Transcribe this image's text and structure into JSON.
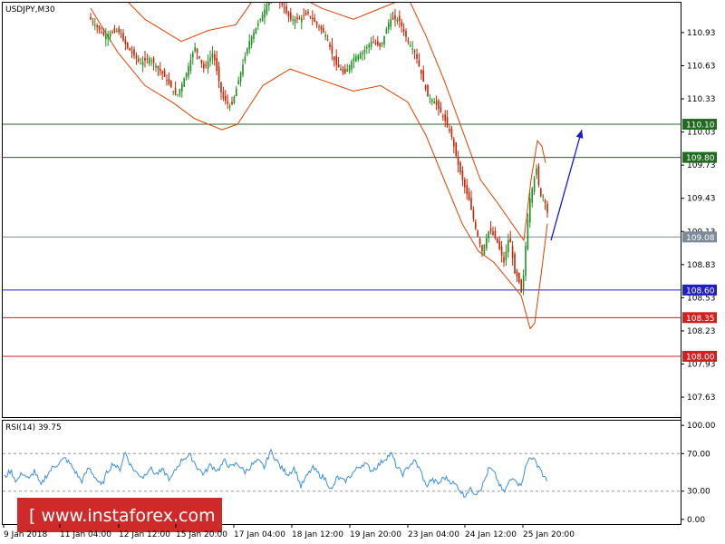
{
  "chart_data": {
    "type": "candlestick",
    "symbol_label": "USDJPY,M30",
    "main_panel": {
      "y_range": [
        107.45,
        111.2
      ],
      "y_ticks": [
        "110.93",
        "110.63",
        "110.33",
        "110.03",
        "109.73",
        "109.43",
        "109.13",
        "108.83",
        "108.53",
        "108.23",
        "107.93",
        "107.63"
      ],
      "horizontal_levels": [
        {
          "value": 110.1,
          "label": "110.10",
          "color": "#1f6b1f"
        },
        {
          "value": 109.8,
          "label": "109.80",
          "color": "#1f6b1f"
        },
        {
          "value": 109.08,
          "label": "109.08",
          "color": "#7a8a99"
        },
        {
          "value": 108.6,
          "label": "108.60",
          "color": "#2020c0"
        },
        {
          "value": 108.35,
          "label": "108.35",
          "color": "#d02020"
        },
        {
          "value": 108.0,
          "label": "108.00",
          "color": "#d02020"
        }
      ],
      "price_path": [
        [
          0,
          111.6
        ],
        [
          25,
          111.35
        ],
        [
          50,
          111.3
        ],
        [
          70,
          111.05
        ],
        [
          88,
          111.15
        ],
        [
          100,
          111.05
        ],
        [
          115,
          110.9
        ],
        [
          130,
          110.95
        ],
        [
          140,
          110.8
        ],
        [
          155,
          110.65
        ],
        [
          165,
          110.7
        ],
        [
          180,
          110.55
        ],
        [
          195,
          110.35
        ],
        [
          205,
          110.55
        ],
        [
          215,
          110.8
        ],
        [
          225,
          110.6
        ],
        [
          235,
          110.75
        ],
        [
          245,
          110.35
        ],
        [
          255,
          110.25
        ],
        [
          265,
          110.55
        ],
        [
          275,
          110.85
        ],
        [
          290,
          111.1
        ],
        [
          300,
          111.3
        ],
        [
          310,
          111.2
        ],
        [
          320,
          111.05
        ],
        [
          330,
          111.05
        ],
        [
          340,
          111.1
        ],
        [
          350,
          111.0
        ],
        [
          360,
          110.9
        ],
        [
          370,
          110.65
        ],
        [
          380,
          110.55
        ],
        [
          390,
          110.7
        ],
        [
          400,
          110.75
        ],
        [
          410,
          110.85
        ],
        [
          420,
          110.8
        ],
        [
          430,
          111.05
        ],
        [
          440,
          111.05
        ],
        [
          450,
          110.85
        ],
        [
          458,
          110.75
        ],
        [
          465,
          110.55
        ],
        [
          472,
          110.35
        ],
        [
          480,
          110.3
        ],
        [
          490,
          110.15
        ],
        [
          498,
          110.0
        ],
        [
          505,
          109.75
        ],
        [
          512,
          109.55
        ],
        [
          518,
          109.4
        ],
        [
          525,
          109.15
        ],
        [
          532,
          108.95
        ],
        [
          540,
          109.15
        ],
        [
          548,
          109.05
        ],
        [
          556,
          108.85
        ],
        [
          562,
          109.1
        ],
        [
          568,
          108.75
        ],
        [
          572,
          108.7
        ],
        [
          576,
          108.55
        ],
        [
          580,
          109.0
        ],
        [
          584,
          109.4
        ],
        [
          588,
          109.55
        ],
        [
          592,
          109.7
        ],
        [
          596,
          109.45
        ],
        [
          600,
          109.45
        ],
        [
          604,
          109.3
        ],
        [
          608,
          109.1
        ]
      ],
      "bollinger_upper": [
        [
          100,
          111.5
        ],
        [
          130,
          111.3
        ],
        [
          160,
          111.05
        ],
        [
          200,
          110.85
        ],
        [
          230,
          110.95
        ],
        [
          260,
          111.0
        ],
        [
          290,
          111.35
        ],
        [
          320,
          111.3
        ],
        [
          355,
          111.15
        ],
        [
          390,
          111.05
        ],
        [
          420,
          111.15
        ],
        [
          450,
          111.25
        ],
        [
          470,
          110.9
        ],
        [
          490,
          110.5
        ],
        [
          510,
          110.05
        ],
        [
          530,
          109.6
        ],
        [
          548,
          109.4
        ],
        [
          565,
          109.2
        ],
        [
          578,
          109.05
        ],
        [
          586,
          109.6
        ],
        [
          593,
          109.95
        ],
        [
          598,
          109.9
        ],
        [
          602,
          109.75
        ]
      ],
      "bollinger_lower": [
        [
          100,
          111.15
        ],
        [
          130,
          110.75
        ],
        [
          160,
          110.45
        ],
        [
          190,
          110.3
        ],
        [
          215,
          110.15
        ],
        [
          245,
          110.05
        ],
        [
          262,
          110.1
        ],
        [
          290,
          110.45
        ],
        [
          320,
          110.6
        ],
        [
          355,
          110.5
        ],
        [
          390,
          110.4
        ],
        [
          420,
          110.45
        ],
        [
          450,
          110.3
        ],
        [
          470,
          110.0
        ],
        [
          490,
          109.6
        ],
        [
          510,
          109.2
        ],
        [
          528,
          108.95
        ],
        [
          545,
          108.85
        ],
        [
          560,
          108.7
        ],
        [
          575,
          108.55
        ],
        [
          585,
          108.25
        ],
        [
          590,
          108.3
        ],
        [
          598,
          108.8
        ],
        [
          604,
          109.2
        ]
      ],
      "forecast_arrow": {
        "from": [
          608,
          109.05
        ],
        "to": [
          642,
          110.05
        ],
        "color": "#1a1ad0"
      }
    },
    "rsi_panel": {
      "label": "RSI(14) 39.75",
      "y_range": [
        -5,
        105
      ],
      "y_ticks": [
        "100.00",
        "70.00",
        "30.00",
        "0.00"
      ],
      "levels": [
        70,
        30
      ],
      "values": [
        [
          5,
          45
        ],
        [
          12,
          52
        ],
        [
          18,
          40
        ],
        [
          25,
          50
        ],
        [
          32,
          42
        ],
        [
          38,
          52
        ],
        [
          45,
          35
        ],
        [
          50,
          45
        ],
        [
          58,
          55
        ],
        [
          65,
          60
        ],
        [
          72,
          65
        ],
        [
          78,
          58
        ],
        [
          85,
          48
        ],
        [
          90,
          40
        ],
        [
          98,
          55
        ],
        [
          105,
          45
        ],
        [
          112,
          35
        ],
        [
          118,
          50
        ],
        [
          125,
          60
        ],
        [
          132,
          52
        ],
        [
          138,
          72
        ],
        [
          144,
          58
        ],
        [
          150,
          50
        ],
        [
          158,
          45
        ],
        [
          165,
          55
        ],
        [
          172,
          48
        ],
        [
          180,
          52
        ],
        [
          188,
          42
        ],
        [
          195,
          55
        ],
        [
          202,
          65
        ],
        [
          210,
          68
        ],
        [
          218,
          55
        ],
        [
          225,
          48
        ],
        [
          232,
          58
        ],
        [
          240,
          52
        ],
        [
          248,
          62
        ],
        [
          255,
          55
        ],
        [
          262,
          60
        ],
        [
          270,
          50
        ],
        [
          278,
          58
        ],
        [
          285,
          62
        ],
        [
          292,
          55
        ],
        [
          298,
          73
        ],
        [
          304,
          65
        ],
        [
          310,
          55
        ],
        [
          318,
          48
        ],
        [
          325,
          55
        ],
        [
          332,
          35
        ],
        [
          338,
          45
        ],
        [
          345,
          55
        ],
        [
          352,
          48
        ],
        [
          360,
          42
        ],
        [
          366,
          30
        ],
        [
          372,
          45
        ],
        [
          380,
          40
        ],
        [
          388,
          48
        ],
        [
          395,
          55
        ],
        [
          402,
          60
        ],
        [
          410,
          52
        ],
        [
          418,
          58
        ],
        [
          425,
          65
        ],
        [
          432,
          70
        ],
        [
          438,
          55
        ],
        [
          445,
          48
        ],
        [
          452,
          58
        ],
        [
          458,
          62
        ],
        [
          465,
          50
        ],
        [
          470,
          35
        ],
        [
          476,
          42
        ],
        [
          484,
          38
        ],
        [
          490,
          45
        ],
        [
          498,
          40
        ],
        [
          505,
          35
        ],
        [
          512,
          25
        ],
        [
          518,
          32
        ],
        [
          525,
          28
        ],
        [
          532,
          35
        ],
        [
          540,
          55
        ],
        [
          546,
          48
        ],
        [
          552,
          35
        ],
        [
          556,
          28
        ],
        [
          562,
          40
        ],
        [
          568,
          45
        ],
        [
          574,
          35
        ],
        [
          580,
          55
        ],
        [
          585,
          68
        ],
        [
          590,
          62
        ],
        [
          596,
          55
        ],
        [
          600,
          45
        ],
        [
          604,
          40
        ]
      ]
    },
    "x_labels": [
      "9 Jan 2018",
      "11 Jan 04:00",
      "12 Jan 12:00",
      "15 Jan 20:00",
      "17 Jan 04:00",
      "18 Jan 12:00",
      "19 Jan 20:00",
      "23 Jan 04:00",
      "24 Jan 12:00",
      "25 Jan 20:00"
    ]
  },
  "watermark": "[ www.instaforex.com ]",
  "colors": {
    "up_candle": "#1f8f1f",
    "down_candle": "#cc2200",
    "bands": "#e04000",
    "rsi": "#3a8fd8"
  }
}
